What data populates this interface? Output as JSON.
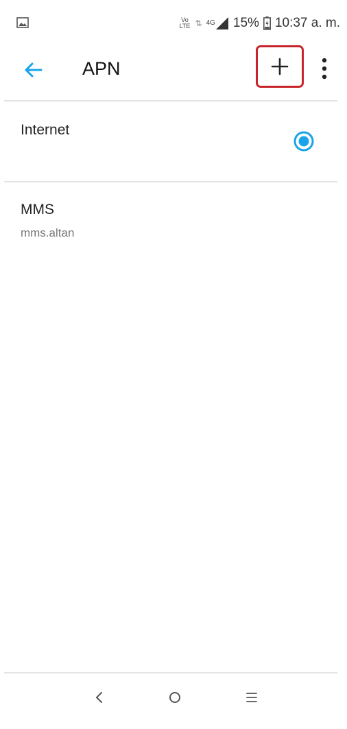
{
  "status_bar": {
    "volte_top": "Vo",
    "volte_bottom": "LTE",
    "data_arrows": "⇅",
    "network_type": "4G",
    "battery_percent": "15%",
    "time": "10:37 a. m.",
    "icons": [
      "image-notification-icon",
      "data-arrows-icon",
      "signal-icon",
      "battery-icon"
    ]
  },
  "app_bar": {
    "title": "APN",
    "back_icon": "arrow-back-icon",
    "add_icon": "plus-icon",
    "more_icon": "more-vertical-icon",
    "highlight_color": "#c8242c"
  },
  "apn_list": [
    {
      "name": "Internet",
      "subtitle": "",
      "selected": true
    },
    {
      "name": "MMS",
      "subtitle": "mms.altan",
      "selected": false
    }
  ],
  "nav_bar": {
    "icons": [
      "back-chevron-icon",
      "home-circle-icon",
      "menu-lines-icon"
    ]
  },
  "colors": {
    "accent": "#1aa3e8",
    "highlight": "#c8242c"
  }
}
